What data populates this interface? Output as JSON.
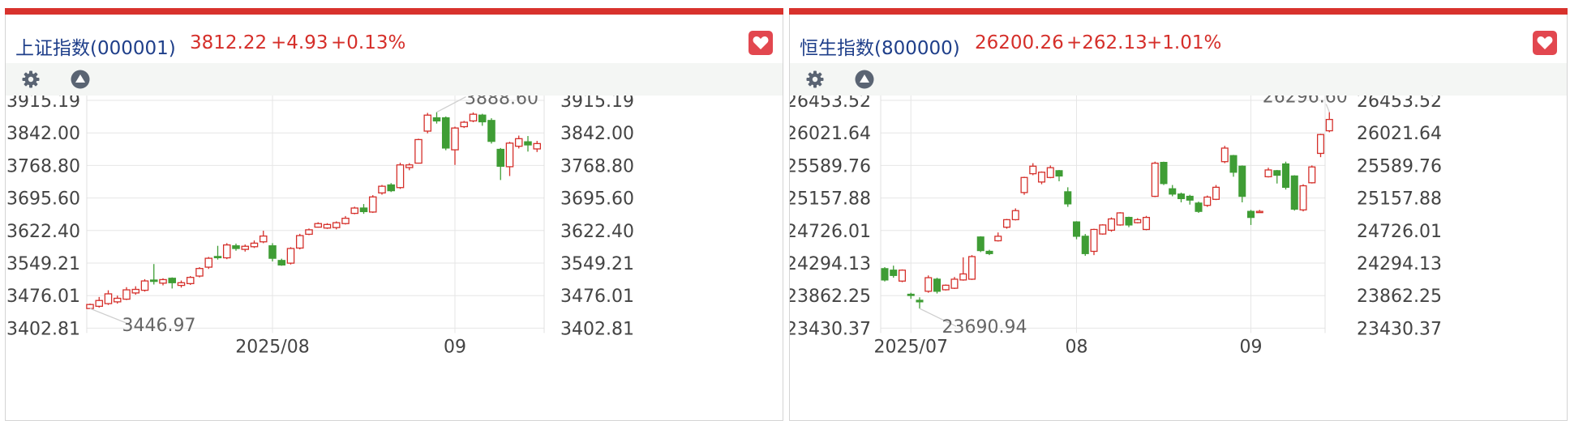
{
  "colors": {
    "up": "#d52f2a",
    "down": "#3f9d35",
    "title": "#1f3f8a",
    "accent_bar": "#d8322d",
    "fav": "#e2474f"
  },
  "toolbar": {
    "icons": [
      "gear-icon",
      "triangle-up-circle-icon"
    ]
  },
  "panels": [
    {
      "name": "上证指数(000001)",
      "price": "3812.22",
      "change": "+4.93",
      "pct": "+0.13%",
      "chart_data": {
        "type": "candlestick",
        "y_ticks": [
          "3915.19",
          "3842.00",
          "3768.80",
          "3695.60",
          "3622.40",
          "3549.21",
          "3476.01",
          "3402.81"
        ],
        "x_ticks": [
          {
            "label": "2025/08",
            "index": 20
          },
          {
            "label": "09",
            "index": 40
          }
        ],
        "max_label": "3888.60",
        "min_label": "3446.97",
        "candles": [
          [
            3446.97,
            3456,
            3446.97,
            3458
          ],
          [
            3452,
            3465,
            3449,
            3473
          ],
          [
            3458,
            3480,
            3455,
            3488
          ],
          [
            3462,
            3470,
            3458,
            3476
          ],
          [
            3468,
            3489,
            3466,
            3495
          ],
          [
            3482,
            3490,
            3478,
            3497
          ],
          [
            3488,
            3509,
            3485,
            3513
          ],
          [
            3511,
            3508,
            3501,
            3547
          ],
          [
            3504,
            3512,
            3499,
            3515
          ],
          [
            3515,
            3505,
            3492,
            3517
          ],
          [
            3499,
            3505,
            3494,
            3510
          ],
          [
            3503,
            3517,
            3500,
            3520
          ],
          [
            3520,
            3537,
            3517,
            3540
          ],
          [
            3540,
            3560,
            3536,
            3563
          ],
          [
            3564,
            3563,
            3557,
            3588
          ],
          [
            3561,
            3590,
            3558,
            3594
          ],
          [
            3588,
            3582,
            3577,
            3593
          ],
          [
            3580,
            3587,
            3575,
            3591
          ],
          [
            3586,
            3594,
            3583,
            3600
          ],
          [
            3597,
            3610,
            3594,
            3622
          ],
          [
            3588,
            3560,
            3553,
            3594
          ],
          [
            3555,
            3545,
            3543,
            3559
          ],
          [
            3549,
            3582,
            3546,
            3585
          ],
          [
            3583,
            3611,
            3580,
            3615
          ],
          [
            3614,
            3624,
            3612,
            3627
          ],
          [
            3630,
            3638,
            3629,
            3641
          ],
          [
            3628,
            3636,
            3626,
            3639
          ],
          [
            3629,
            3640,
            3625,
            3643
          ],
          [
            3638,
            3650,
            3636,
            3655
          ],
          [
            3661,
            3673,
            3659,
            3676
          ],
          [
            3673,
            3665,
            3660,
            3682
          ],
          [
            3664,
            3698,
            3662,
            3702
          ],
          [
            3707,
            3722,
            3703,
            3725
          ],
          [
            3725,
            3712,
            3709,
            3729
          ],
          [
            3719,
            3770,
            3716,
            3775
          ],
          [
            3764,
            3770,
            3758,
            3774
          ],
          [
            3774,
            3827,
            3773,
            3829
          ],
          [
            3846,
            3882,
            3841,
            3887
          ],
          [
            3876,
            3869,
            3863,
            3888.6
          ],
          [
            3876,
            3808,
            3803,
            3879
          ],
          [
            3804,
            3853,
            3770,
            3856
          ],
          [
            3856,
            3866,
            3853,
            3869
          ],
          [
            3869,
            3884,
            3866,
            3888
          ],
          [
            3882,
            3867,
            3858,
            3885
          ],
          [
            3870,
            3823,
            3818,
            3875
          ],
          [
            3805,
            3767,
            3736,
            3808
          ],
          [
            3766,
            3819,
            3745,
            3822
          ],
          [
            3812,
            3829,
            3807,
            3836
          ],
          [
            3822,
            3815,
            3800,
            3835
          ],
          [
            3806,
            3818,
            3799,
            3824
          ]
        ]
      }
    },
    {
      "name": "恒生指数(800000)",
      "price": "26200.26",
      "change": "+262.13",
      "pct": "+1.01%",
      "chart_data": {
        "type": "candlestick",
        "y_ticks": [
          "26453.52",
          "26021.64",
          "25589.76",
          "25157.88",
          "24726.01",
          "24294.13",
          "23862.25",
          "23430.37"
        ],
        "x_ticks": [
          {
            "label": "2025/07",
            "index": 3
          },
          {
            "label": "08",
            "index": 22
          },
          {
            "label": "09",
            "index": 42
          }
        ],
        "max_label": "26296.60",
        "min_label": "23690.94",
        "candles": [
          [
            24220,
            24070,
            24050,
            24240
          ],
          [
            24200,
            24130,
            24100,
            24260
          ],
          [
            24055,
            24200,
            24040,
            24210
          ],
          [
            23880,
            23870,
            23820,
            23900
          ],
          [
            23800,
            23780,
            23690.94,
            23840
          ],
          [
            23920,
            24100,
            23900,
            24130
          ],
          [
            24080,
            23920,
            23890,
            24100
          ],
          [
            23940,
            24000,
            23930,
            24010
          ],
          [
            23960,
            24080,
            23950,
            24110
          ],
          [
            24070,
            24150,
            24060,
            24370
          ],
          [
            24080,
            24380,
            24070,
            24400
          ],
          [
            24640,
            24460,
            24440,
            24650
          ],
          [
            24450,
            24420,
            24400,
            24470
          ],
          [
            24590,
            24650,
            24580,
            24700
          ],
          [
            24770,
            24870,
            24750,
            24880
          ],
          [
            24870,
            24990,
            24860,
            25020
          ],
          [
            25230,
            25430,
            25200,
            25440
          ],
          [
            25480,
            25580,
            25460,
            25620
          ],
          [
            25370,
            25500,
            25340,
            25510
          ],
          [
            25430,
            25560,
            25420,
            25590
          ],
          [
            25520,
            25450,
            25380,
            25530
          ],
          [
            25240,
            25080,
            25040,
            25300
          ],
          [
            24840,
            24650,
            24610,
            24850
          ],
          [
            24650,
            24420,
            24390,
            24680
          ],
          [
            24450,
            24740,
            24400,
            24750
          ],
          [
            24680,
            24800,
            24670,
            24810
          ],
          [
            24730,
            24880,
            24710,
            24900
          ],
          [
            24800,
            24960,
            24790,
            24970
          ],
          [
            24900,
            24800,
            24770,
            24910
          ],
          [
            24830,
            24870,
            24820,
            24890
          ],
          [
            24740,
            24900,
            24730,
            24920
          ],
          [
            25180,
            25620,
            25170,
            25640
          ],
          [
            25630,
            25350,
            25330,
            25640
          ],
          [
            25280,
            25210,
            25180,
            25330
          ],
          [
            25210,
            25150,
            25100,
            25230
          ],
          [
            25180,
            25130,
            25070,
            25200
          ],
          [
            25090,
            24980,
            24960,
            25110
          ],
          [
            25060,
            25170,
            25040,
            25190
          ],
          [
            25140,
            25300,
            25130,
            25330
          ],
          [
            25640,
            25820,
            25620,
            25850
          ],
          [
            25720,
            25500,
            25440,
            25730
          ],
          [
            25580,
            25180,
            25100,
            25590
          ],
          [
            24980,
            24900,
            24800,
            25000
          ],
          [
            24980,
            24980,
            24970,
            25000
          ],
          [
            25440,
            25530,
            25430,
            25560
          ],
          [
            25520,
            25460,
            25350,
            25530
          ],
          [
            25610,
            25300,
            25270,
            25640
          ],
          [
            25450,
            25010,
            24990,
            25460
          ],
          [
            25000,
            25320,
            24980,
            25340
          ],
          [
            25360,
            25570,
            25350,
            25590
          ],
          [
            25750,
            26000,
            25700,
            26010
          ],
          [
            26050,
            26200,
            26030,
            26296.6
          ]
        ]
      }
    }
  ]
}
